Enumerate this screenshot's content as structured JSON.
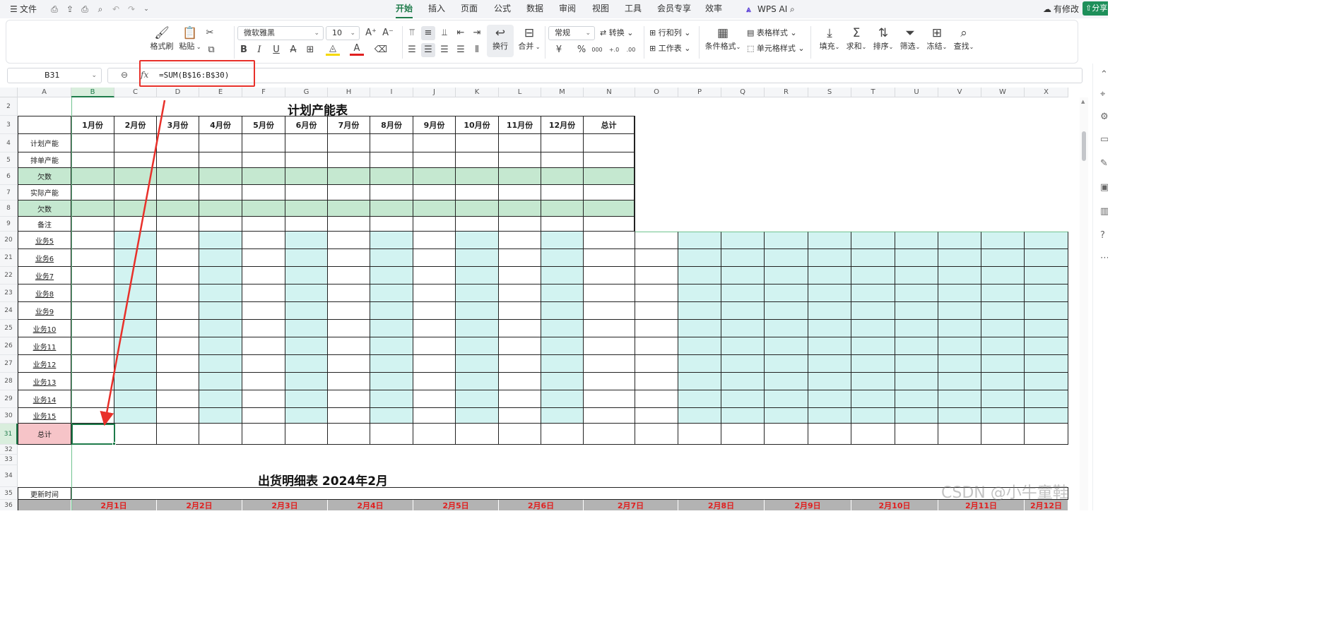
{
  "menu": {
    "hamburger": "☰",
    "file": "文件",
    "quick_icons": [
      "save-icon",
      "export-icon",
      "print-icon",
      "print-preview-icon",
      "undo-icon",
      "redo-icon",
      "more-icon"
    ],
    "tabs": [
      "开始",
      "插入",
      "页面",
      "公式",
      "数据",
      "审阅",
      "视图",
      "工具",
      "会员专享",
      "效率"
    ],
    "active_tab": "开始",
    "wps_ai": "WPS AI",
    "has_changes": "有修改",
    "share": "分享"
  },
  "ribbon": {
    "format_painter": "格式刷",
    "paste": "粘贴",
    "font_name": "微软雅黑",
    "font_size": "10",
    "wrap": "换行",
    "merge": "合并",
    "number_format": "常规",
    "convert": "转换",
    "rows_cols": "行和列",
    "worksheet": "工作表",
    "conditional_format": "条件格式",
    "table_style": "表格样式",
    "cell_style": "单元格样式",
    "fill": "填充",
    "sum": "求和",
    "sort": "排序",
    "filter": "筛选",
    "freeze": "冻结",
    "find": "查找",
    "currency_symbol": "¥",
    "percent_symbol": "%",
    "thousands_symbol": "000",
    "decimal_inc": "+.0",
    "decimal_dec": ".00"
  },
  "formula_bar": {
    "cell_ref": "B31",
    "fx": "fx",
    "formula": "=SUM(B$16:B$30)"
  },
  "columns": [
    "A",
    "B",
    "C",
    "D",
    "E",
    "F",
    "G",
    "H",
    "I",
    "J",
    "K",
    "L",
    "M",
    "N",
    "O",
    "P",
    "Q",
    "R",
    "S",
    "T",
    "U",
    "V",
    "W",
    "X"
  ],
  "rows": [
    "2",
    "3",
    "4",
    "5",
    "6",
    "7",
    "8",
    "9",
    "20",
    "21",
    "22",
    "23",
    "24",
    "25",
    "26",
    "27",
    "28",
    "29",
    "30",
    "31",
    "32",
    "33",
    "34",
    "35",
    "36"
  ],
  "sheet": {
    "title1": "计划产能表",
    "month_headers": [
      "1月份",
      "2月份",
      "3月份",
      "4月份",
      "5月份",
      "6月份",
      "7月份",
      "8月份",
      "9月份",
      "10月份",
      "11月份",
      "12月份",
      "总计"
    ],
    "row_labels": [
      "计划产能",
      "排单产能",
      "欠数",
      "实际产能",
      "欠数",
      "备注"
    ],
    "business_labels": [
      "业务5",
      "业务6",
      "业务7",
      "业务8",
      "业务9",
      "业务10",
      "业务11",
      "业务12",
      "业务13",
      "业务14",
      "业务15"
    ],
    "total_label": "总计",
    "title2": "出货明细表 2024年2月",
    "update_time_label": "更新时间",
    "dates": [
      "2月1日",
      "2月2日",
      "2月3日",
      "2月4日",
      "2月5日",
      "2月6日",
      "2月7日",
      "2月8日",
      "2月9日",
      "2月10日",
      "2月11日",
      "2月12日"
    ]
  },
  "watermark": "CSDN @小牛童鞋",
  "colors": {
    "accent": "#1e7b4a",
    "annotation_red": "#e8302a",
    "shortfall_green": "#c5e8d0",
    "alt_column_teal": "#d2f3f1",
    "total_pink": "#f6c4c8",
    "date_header_gray": "#b3b3b3",
    "date_text_red": "#e02020"
  }
}
